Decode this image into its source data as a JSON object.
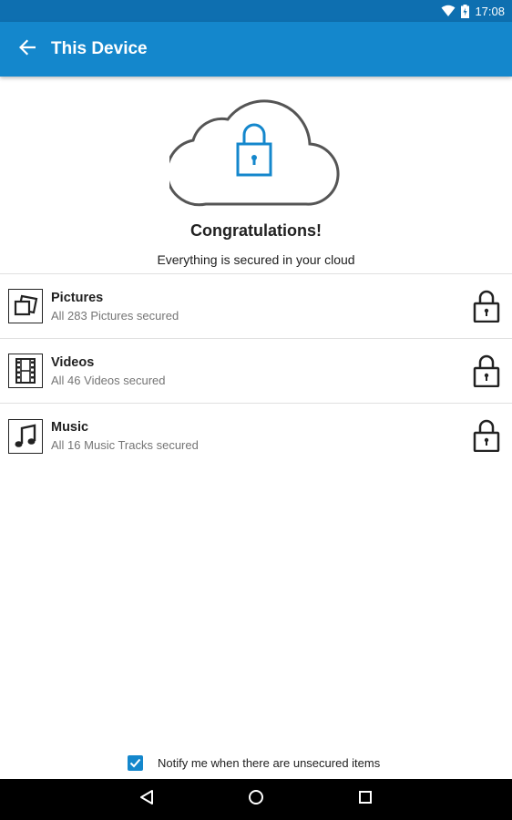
{
  "status_bar": {
    "time": "17:08",
    "icons": [
      "wifi-icon",
      "battery-charging-icon"
    ]
  },
  "app_bar": {
    "title": "This Device",
    "back_icon": "arrow-back-icon"
  },
  "hero": {
    "icon": "cloud-lock-icon",
    "heading": "Congratulations!",
    "subheading": "Everything is secured in your cloud"
  },
  "items": [
    {
      "title": "Pictures",
      "subtitle": "All 283 Pictures secured",
      "icon": "pictures-icon",
      "status_icon": "lock-icon"
    },
    {
      "title": "Videos",
      "subtitle": "All 46 Videos secured",
      "icon": "film-icon",
      "status_icon": "lock-icon"
    },
    {
      "title": "Music",
      "subtitle": "All 16 Music Tracks secured",
      "icon": "music-note-icon",
      "status_icon": "lock-icon"
    }
  ],
  "notify": {
    "label": "Notify me when there are unsecured items",
    "checked": true
  },
  "nav": {
    "buttons": [
      "back-triangle-icon",
      "home-circle-icon",
      "recents-square-icon"
    ]
  },
  "colors": {
    "status_bar": "#0e6fb0",
    "app_bar": "#1487cc",
    "accent": "#1487cc"
  }
}
